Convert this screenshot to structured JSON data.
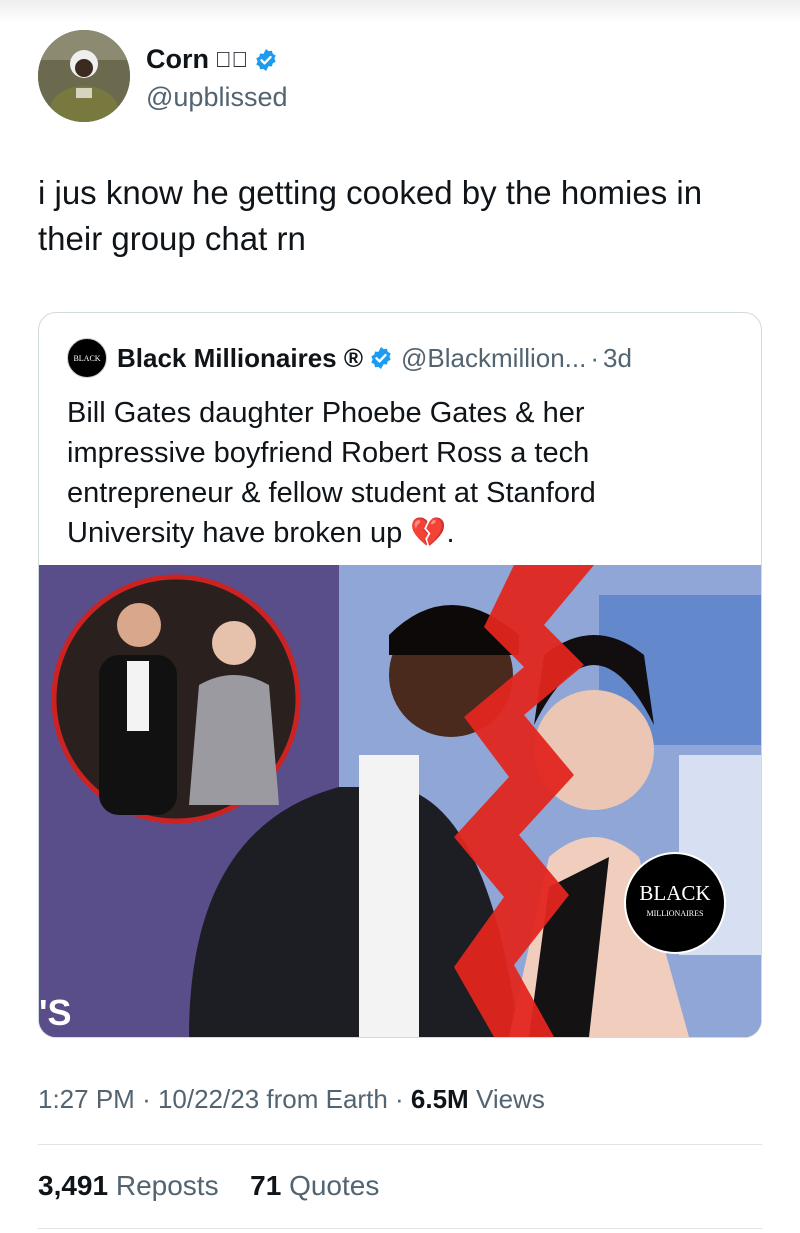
{
  "author": {
    "name": "Corn",
    "name_decor": "✧⃟",
    "handle": "@upblissed",
    "verified": true
  },
  "tweet": {
    "text": "i jus know he getting cooked by the homies in their group chat rn"
  },
  "quoted": {
    "logo_text": "BLACK",
    "name": "Black Millionaires ®",
    "handle": "@Blackmillion...",
    "separator": "·",
    "age": "3d",
    "text": "Bill Gates daughter Phoebe Gates & her impressive boyfriend Robert Ross a tech entrepreneur & fellow student at Stanford University have broken up 💔.",
    "image": {
      "watermark_title": "BLACK",
      "watermark_sub": "MILLIONAIRES"
    }
  },
  "meta": {
    "time": "1:27 PM",
    "date": "10/22/23",
    "source": "from Earth",
    "views_count": "6.5M",
    "views_label": "Views"
  },
  "stats": {
    "reposts_count": "3,491",
    "reposts_label": "Reposts",
    "quotes_count": "71",
    "quotes_label": "Quotes"
  },
  "colors": {
    "verified_blue": "#1d9bf0",
    "secondary_text": "#536471",
    "border": "#cfd9de"
  }
}
